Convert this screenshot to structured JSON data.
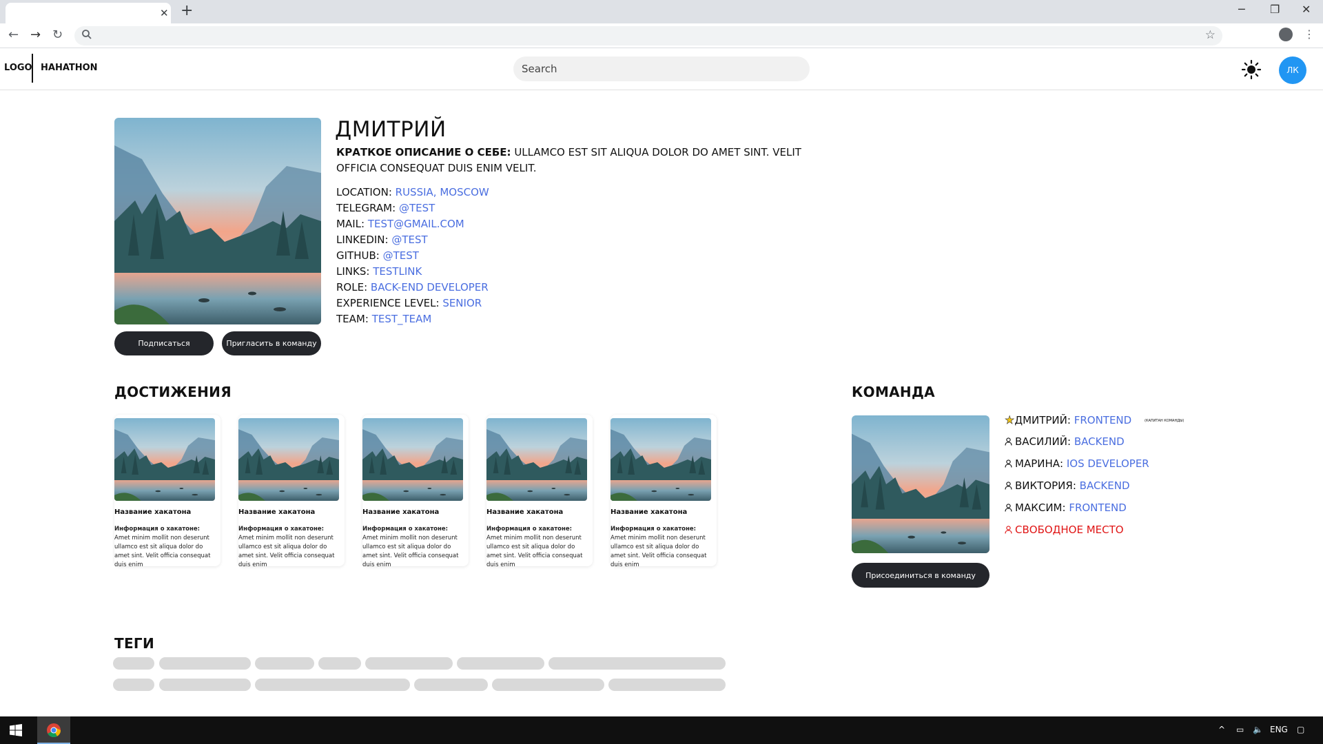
{
  "browser": {
    "tab_close": "✕",
    "new_tab": "+",
    "window_controls": [
      "─",
      "❐",
      "✕"
    ],
    "address_value": ""
  },
  "header": {
    "logo": "LOGO",
    "app_name": "HAHATHON",
    "search_placeholder": "Search",
    "avatar_label": "ЛК"
  },
  "profile": {
    "name": "ДМИТРИЙ",
    "bio_label": "КРАТКОЕ ОПИСАНИЕ О СЕБЕ:",
    "bio_text": "ULLAMCO EST SIT ALIQUA DOLOR DO AMET SINT. VELIT OFFICIA CONSEQUAT DUIS ENIM VELIT.",
    "fields": [
      {
        "label": "LOCATION:",
        "value": "RUSSIA, MOSCOW"
      },
      {
        "label": "TELEGRAM:",
        "value": "@TEST"
      },
      {
        "label": "MAIL:",
        "value": "TEST@GMAIL.COM"
      },
      {
        "label": "LINKEDIN:",
        "value": "@TEST"
      },
      {
        "label": "GITHUB:",
        "value": "@TEST"
      },
      {
        "label": "LINKS:",
        "value": "TESTLINK"
      },
      {
        "label": "ROLE:",
        "value": "BACK-END DEVELOPER"
      },
      {
        "label": "EXPERIENCE LEVEL:",
        "value": "SENIOR"
      },
      {
        "label": "TEAM:",
        "value": "TEST_TEAM"
      }
    ],
    "subscribe_label": "Подписаться",
    "invite_label": "Пригласить в команду"
  },
  "achievements": {
    "title": "ДОСТИЖЕНИЯ",
    "cards": [
      {
        "title": "Название хакатона",
        "info_label": "Информация о хакатоне:",
        "info_text": "Amet minim mollit non deserunt ullamco est sit aliqua dolor do amet sint. Velit officia consequat duis enim"
      },
      {
        "title": "Название хакатона",
        "info_label": "Информация о хакатоне:",
        "info_text": "Amet minim mollit non deserunt ullamco est sit aliqua dolor do amet sint. Velit officia consequat duis enim"
      },
      {
        "title": "Название хакатона",
        "info_label": "Информация о хакатоне:",
        "info_text": "Amet minim mollit non deserunt ullamco est sit aliqua dolor do amet sint. Velit officia consequat duis enim"
      },
      {
        "title": "Название хакатона",
        "info_label": "Информация о хакатоне:",
        "info_text": "Amet minim mollit non deserunt ullamco est sit aliqua dolor do amet sint. Velit officia consequat duis enim"
      },
      {
        "title": "Название хакатона",
        "info_label": "Информация о хакатоне:",
        "info_text": "Amet minim mollit non deserunt ullamco est sit aliqua dolor do amet sint. Velit officia consequat duis enim"
      }
    ]
  },
  "team": {
    "title": "КОМАНДА",
    "join_label": "Присоединиться в команду",
    "captain_note": "(КАПИТАН КОМАНДЫ)",
    "members": [
      {
        "name": "ДМИТРИЙ:",
        "role": "FRONTEND",
        "captain": true
      },
      {
        "name": "ВАСИЛИЙ:",
        "role": "BACKEND"
      },
      {
        "name": "МАРИНА:",
        "role": "IOS DEVELOPER"
      },
      {
        "name": "ВИКТОРИЯ:",
        "role": "BACKEND"
      },
      {
        "name": "МАКСИМ:",
        "role": "FRONTEND"
      }
    ],
    "free_slot": "СВОБОДНОЕ МЕСТО",
    "accent_color": "#4a6ee0",
    "free_color": "#e01515"
  },
  "tags": {
    "title": "ТЕГИ"
  },
  "taskbar": {
    "language": "ENG"
  }
}
